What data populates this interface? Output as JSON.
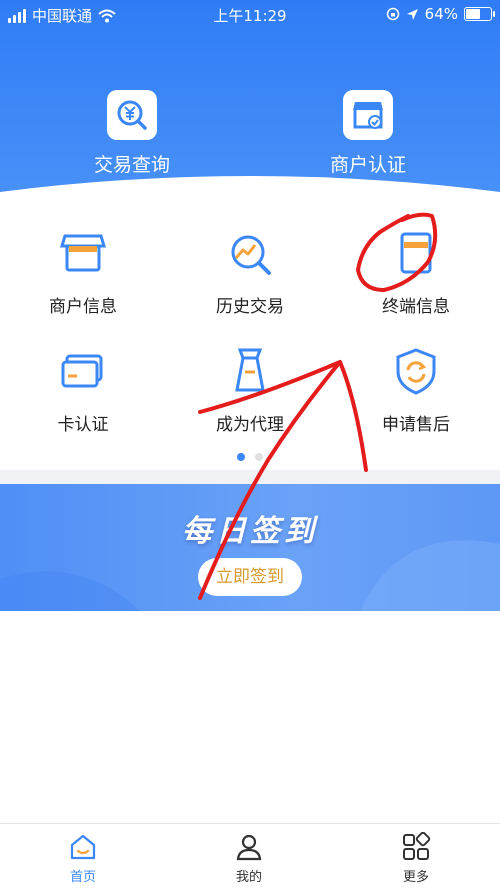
{
  "status_bar": {
    "carrier": "中国联通",
    "time": "上午11:29",
    "battery": "64%",
    "battery_level": 0.64
  },
  "top_actions": [
    {
      "label": "交易查询",
      "icon": "yuan-search-icon"
    },
    {
      "label": "商户认证",
      "icon": "shop-verified-icon"
    }
  ],
  "grid": [
    {
      "label": "商户信息",
      "icon": "shop-icon"
    },
    {
      "label": "历史交易",
      "icon": "history-chart-icon"
    },
    {
      "label": "终端信息",
      "icon": "terminal-card-icon"
    },
    {
      "label": "卡认证",
      "icon": "bank-card-icon"
    },
    {
      "label": "成为代理",
      "icon": "tie-icon"
    },
    {
      "label": "申请售后",
      "icon": "shield-refresh-icon"
    }
  ],
  "banner": {
    "title": "每日签到",
    "button": "立即签到"
  },
  "tabbar": [
    {
      "label": "首页",
      "icon": "home-icon",
      "active": true
    },
    {
      "label": "我的",
      "icon": "user-icon",
      "active": false
    },
    {
      "label": "更多",
      "icon": "more-grid-icon",
      "active": false
    }
  ],
  "colors": {
    "primary": "#3a87f5",
    "accent_orange": "#f5a23a",
    "annotation_red": "#e51c1c"
  }
}
